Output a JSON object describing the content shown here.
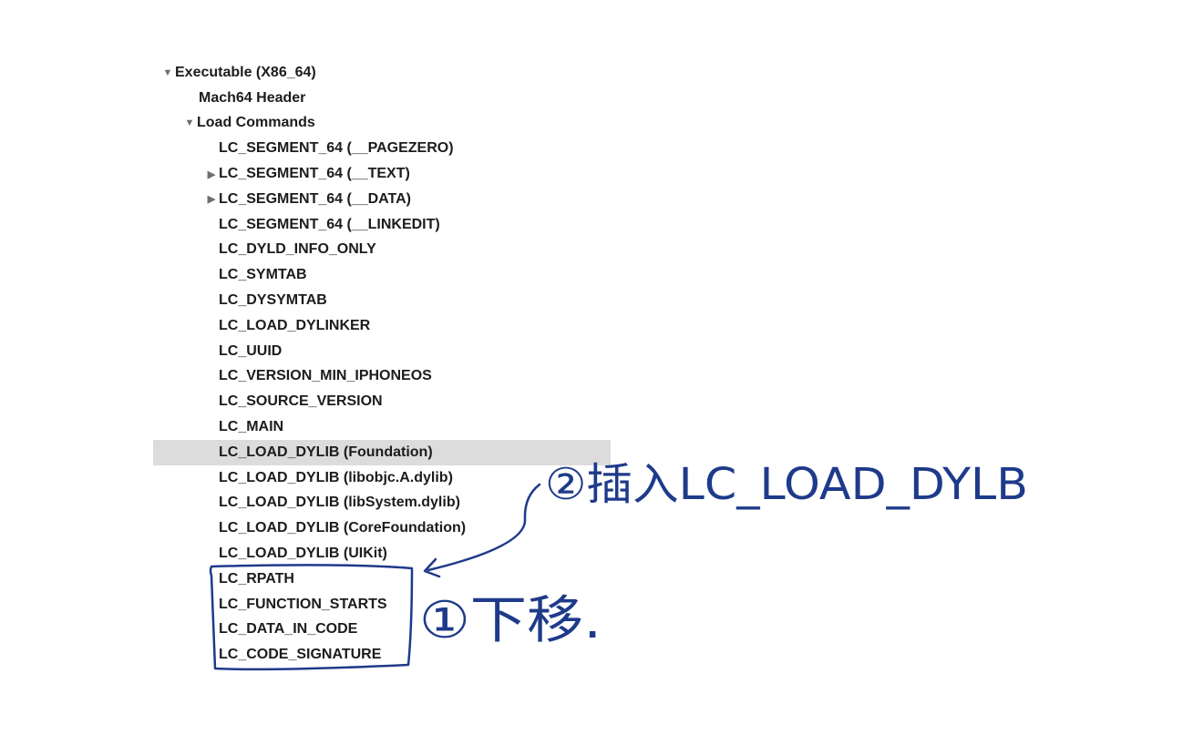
{
  "tree": {
    "root": {
      "label": "Executable  (X86_64)",
      "expanded": true
    },
    "header": {
      "label": "Mach64 Header"
    },
    "load_commands": {
      "label": "Load Commands",
      "expanded": true
    },
    "items": [
      {
        "label": "LC_SEGMENT_64 (__PAGEZERO)",
        "disclosure": "none"
      },
      {
        "label": "LC_SEGMENT_64 (__TEXT)",
        "disclosure": "collapsed"
      },
      {
        "label": "LC_SEGMENT_64 (__DATA)",
        "disclosure": "collapsed"
      },
      {
        "label": "LC_SEGMENT_64 (__LINKEDIT)",
        "disclosure": "none"
      },
      {
        "label": "LC_DYLD_INFO_ONLY",
        "disclosure": "none"
      },
      {
        "label": "LC_SYMTAB",
        "disclosure": "none"
      },
      {
        "label": "LC_DYSYMTAB",
        "disclosure": "none"
      },
      {
        "label": "LC_LOAD_DYLINKER",
        "disclosure": "none"
      },
      {
        "label": "LC_UUID",
        "disclosure": "none"
      },
      {
        "label": "LC_VERSION_MIN_IPHONEOS",
        "disclosure": "none"
      },
      {
        "label": "LC_SOURCE_VERSION",
        "disclosure": "none"
      },
      {
        "label": "LC_MAIN",
        "disclosure": "none"
      },
      {
        "label": "LC_LOAD_DYLIB (Foundation)",
        "disclosure": "none",
        "selected": true
      },
      {
        "label": "LC_LOAD_DYLIB (libobjc.A.dylib)",
        "disclosure": "none"
      },
      {
        "label": "LC_LOAD_DYLIB (libSystem.dylib)",
        "disclosure": "none"
      },
      {
        "label": "LC_LOAD_DYLIB (CoreFoundation)",
        "disclosure": "none"
      },
      {
        "label": "LC_LOAD_DYLIB (UIKit)",
        "disclosure": "none"
      },
      {
        "label": "LC_RPATH",
        "disclosure": "none"
      },
      {
        "label": "LC_FUNCTION_STARTS",
        "disclosure": "none"
      },
      {
        "label": "LC_DATA_IN_CODE",
        "disclosure": "none"
      },
      {
        "label": "LC_CODE_SIGNATURE",
        "disclosure": "none"
      }
    ]
  },
  "annotations": {
    "step1": "①下移.",
    "step2": "②插入LC_LOAD_DYLB",
    "ink_color": "#1e3a8a"
  },
  "icons": {
    "expanded": "disclosure-expanded-icon",
    "collapsed": "disclosure-collapsed-icon"
  },
  "colors": {
    "selection": "#dcdcdc",
    "text": "#1c1c1c",
    "disclosure": "#6e6e6e"
  }
}
